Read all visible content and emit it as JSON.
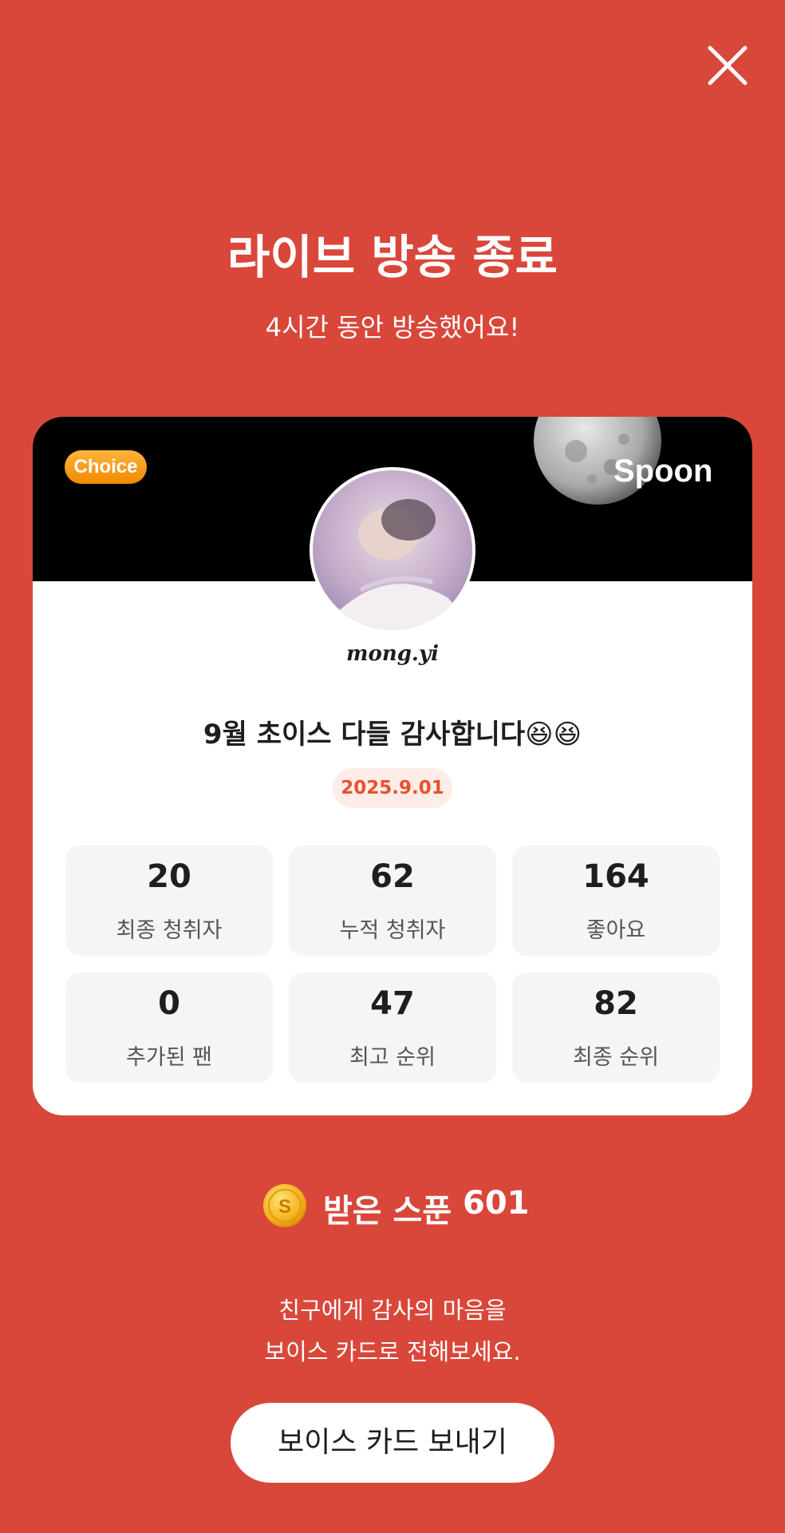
{
  "header": {
    "title": "라이브 방송 종료",
    "subtitle": "4시간 동안 방송했어요!"
  },
  "card": {
    "badge": "Choice",
    "brand": "Spoon",
    "username": "mong.yi",
    "broadcast_title": "9월 초이스 다들 감사합니다😆😆",
    "date": "2025.9.01",
    "stats": [
      {
        "value": "20",
        "label": "최종 청취자"
      },
      {
        "value": "62",
        "label": "누적 청취자"
      },
      {
        "value": "164",
        "label": "좋아요"
      },
      {
        "value": "0",
        "label": "추가된 팬"
      },
      {
        "value": "47",
        "label": "최고 순위"
      },
      {
        "value": "82",
        "label": "최종 순위"
      }
    ]
  },
  "spoons": {
    "label": "받은 스푼",
    "count": "601",
    "coin_letter": "S"
  },
  "message": {
    "line1": "친구에게 감사의 마음을",
    "line2": "보이스 카드로 전해보세요."
  },
  "actions": {
    "voice_card_button": "보이스 카드 보내기"
  },
  "colors": {
    "background": "#D9473A",
    "accent_orange": "#F08A00",
    "date_text": "#E5532C"
  },
  "icons": {
    "close": "close-icon",
    "coin": "spoon-coin-icon",
    "moon": "moon-icon",
    "avatar": "avatar-image"
  }
}
